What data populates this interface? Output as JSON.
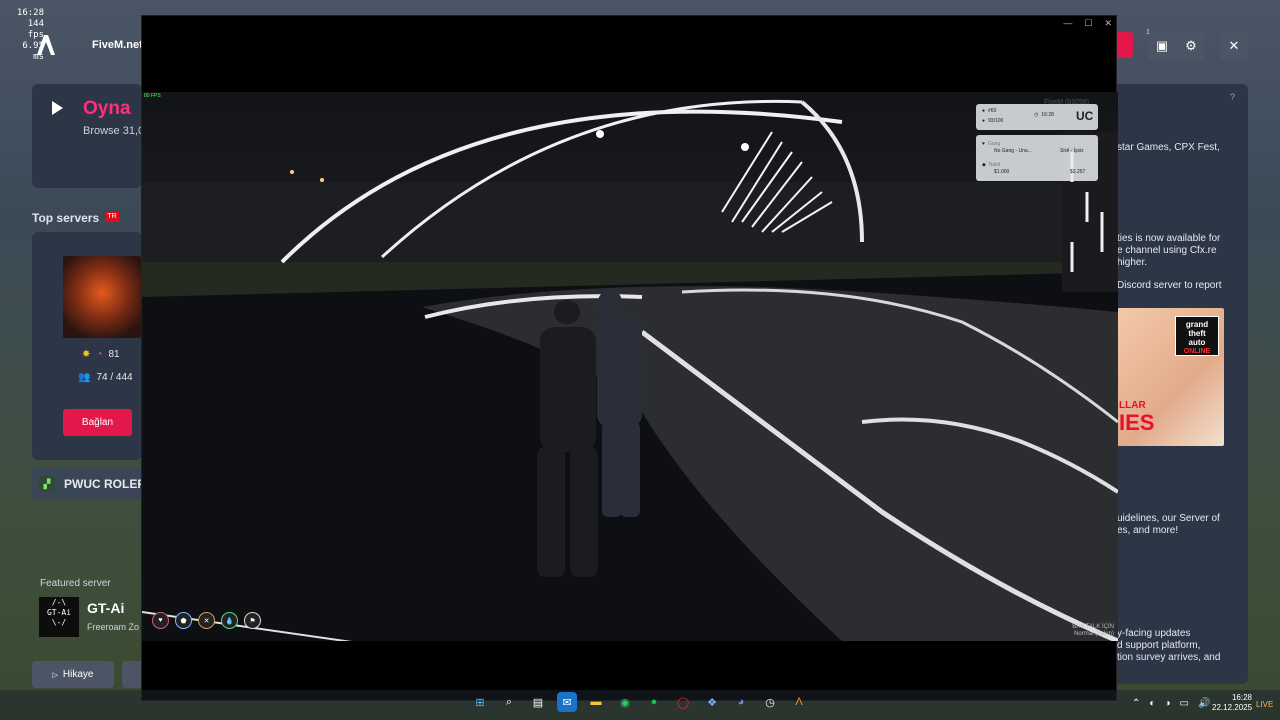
{
  "perf": {
    "time": "16:28",
    "fps": "144 fps",
    "ms": "6.95 ms"
  },
  "launcher": {
    "brand": "FiveM.net",
    "badge_count": "1",
    "play": {
      "title": "Oyna",
      "subtitle": "Browse 31,0"
    },
    "top_servers": {
      "title": "Top servers",
      "flag": "TR"
    },
    "server": {
      "boost": "81",
      "players": "74 / 444",
      "connect": "Bağlan"
    },
    "pwuc": {
      "label": "PWUC ROLEP"
    },
    "featured": {
      "label": "Featured server",
      "name": "GT-Ai",
      "sub": "Freeroam Zo",
      "logo_text": "/-\\\nGT-Ai\n\\-/"
    },
    "history_button": "Hikaye",
    "news": [
      "star Games, CPX Fest,",
      "ties is now available for",
      "e channel using Cfx.re",
      "higher.",
      "Discord server to report",
      "uidelines, our Server of",
      "es, and more!",
      "y-facing updates",
      "d support platform,",
      "tion survey arrives, and"
    ],
    "gta_card": {
      "logo_line1": "grand",
      "logo_line2": "theft",
      "logo_line3": "auto",
      "logo_online": "ONLINE",
      "sub": "LLAR",
      "title": "IES"
    },
    "help": "?"
  },
  "game": {
    "fps_tag": "80 FPS",
    "hud": {
      "id": "#60",
      "players": "93/100",
      "clock": "16:28",
      "gang_label": "Gang",
      "gang": "No Gang - Una...",
      "job": "Sivil - İşsiz",
      "cash_label": "Nakit",
      "cash": "$1.000",
      "bank": "$3.257",
      "watermark": "FiveM (b3258)"
    },
    "talk": {
      "key": "BAS",
      "label": "TALK İÇİN",
      "mode": "Normal (Yakın)"
    }
  },
  "taskbar": {
    "time": "16:28",
    "date": "22.12.2025",
    "notif": "LIVE"
  }
}
